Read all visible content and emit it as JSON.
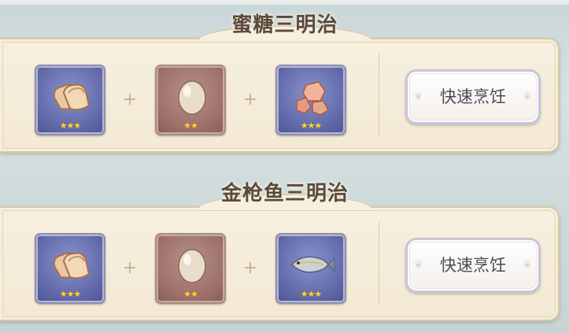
{
  "recipes": [
    {
      "title": "蜜糖三明治",
      "ingredients": [
        {
          "name": "bread",
          "icon": "bread-icon",
          "rarity": "blue",
          "stars": "★★★"
        },
        {
          "name": "egg",
          "icon": "egg-icon",
          "rarity": "brown",
          "stars": "★★"
        },
        {
          "name": "sweet-flower-sugar",
          "icon": "sugar-icon",
          "rarity": "blue",
          "stars": "★★★"
        }
      ],
      "plus": "+",
      "button_label": "快速烹饪"
    },
    {
      "title": "金枪鱼三明治",
      "ingredients": [
        {
          "name": "bread",
          "icon": "bread-icon",
          "rarity": "blue",
          "stars": "★★★"
        },
        {
          "name": "egg",
          "icon": "egg-icon",
          "rarity": "brown",
          "stars": "★★"
        },
        {
          "name": "tuna",
          "icon": "tuna-fish-icon",
          "rarity": "blue",
          "stars": "★★★"
        }
      ],
      "plus": "+",
      "button_label": "快速烹饪"
    }
  ],
  "colors": {
    "frame_blue": "#5f67a7",
    "frame_brown": "#9a6f68",
    "card": "#f3e9d4",
    "star": "#ffd23a"
  }
}
